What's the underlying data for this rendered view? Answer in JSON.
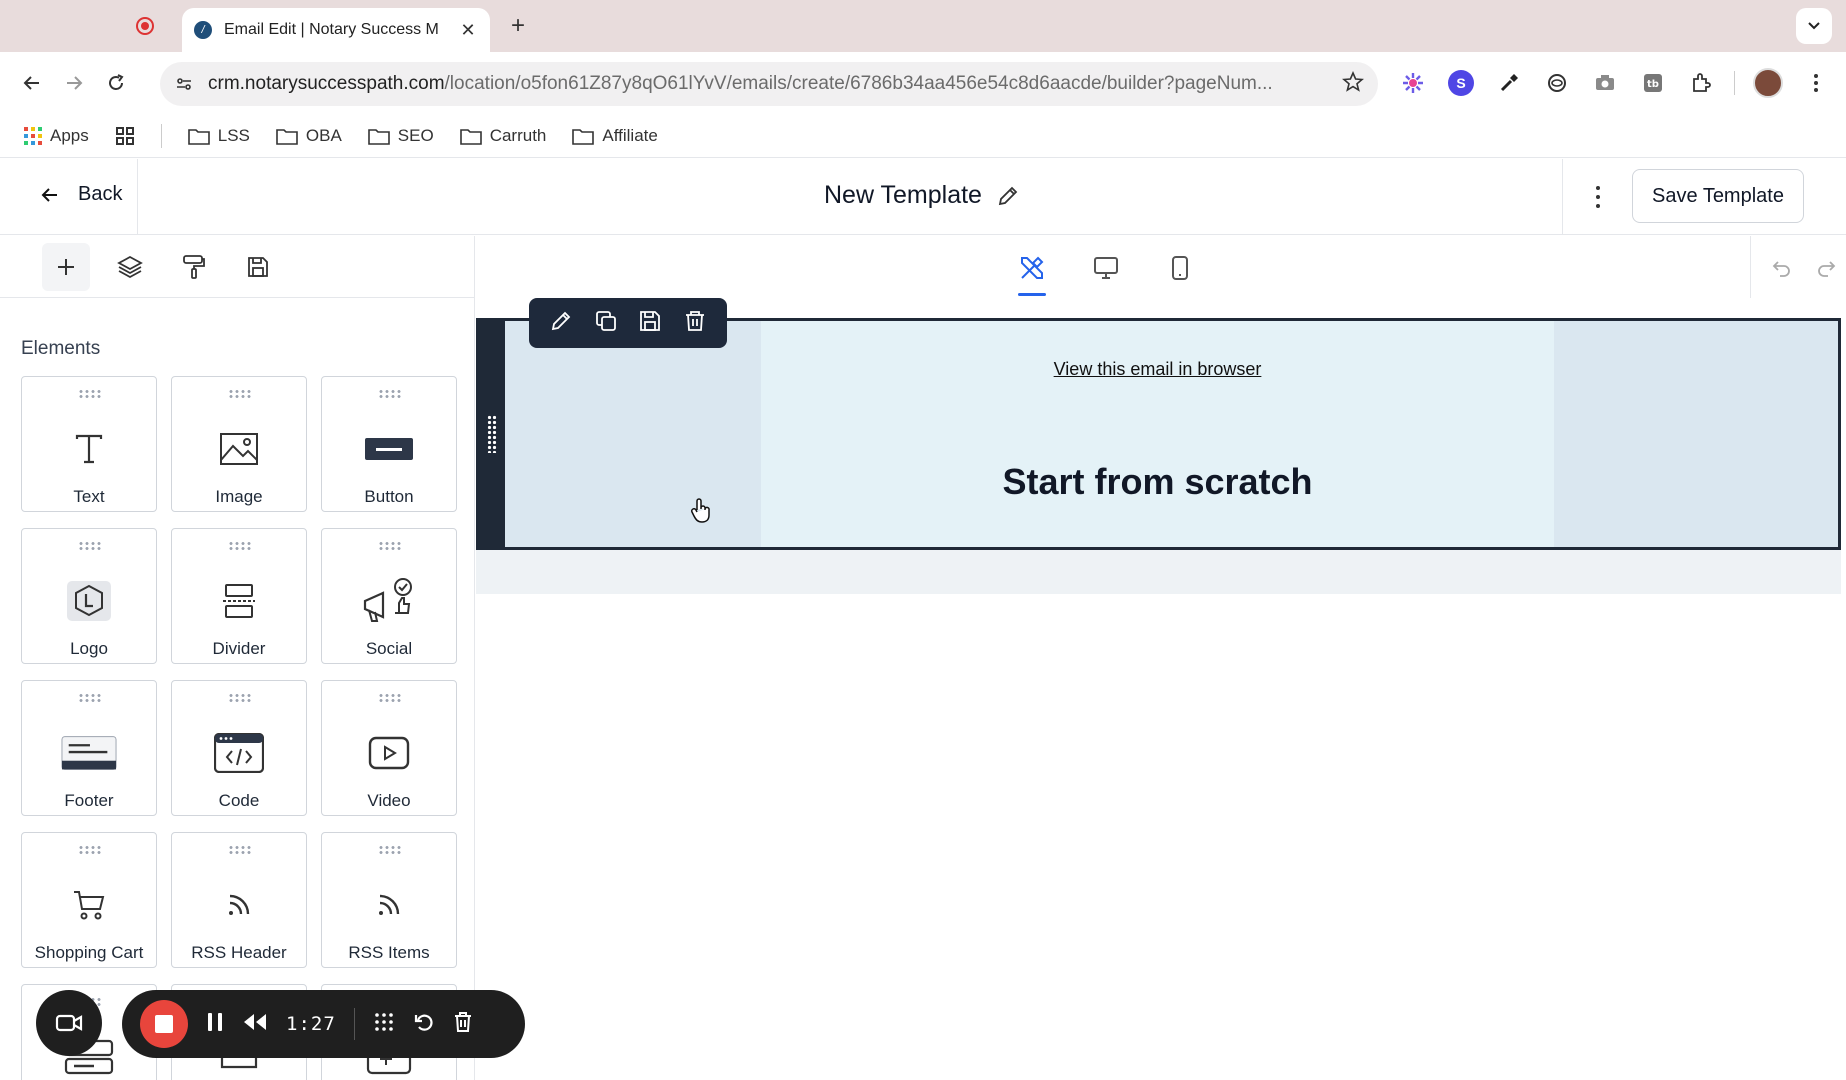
{
  "browser": {
    "tab_title": "Email Edit | Notary Success M",
    "url_host": "crm.notarysuccesspath.com",
    "url_path": "/location/o5fon61Z87y8qO61lYvV/emails/create/6786b34aa456e54c8d6aacde/builder?pageNum...",
    "bookmarks": [
      "Apps",
      "LSS",
      "OBA",
      "SEO",
      "Carruth",
      "Affiliate"
    ]
  },
  "header": {
    "back_label": "Back",
    "template_name": "New Template",
    "save_label": "Save Template"
  },
  "panel": {
    "title": "Elements",
    "elements": [
      {
        "label": "Text",
        "icon": "text-icon"
      },
      {
        "label": "Image",
        "icon": "image-icon"
      },
      {
        "label": "Button",
        "icon": "button-icon"
      },
      {
        "label": "Logo",
        "icon": "logo-icon"
      },
      {
        "label": "Divider",
        "icon": "divider-icon"
      },
      {
        "label": "Social",
        "icon": "social-icon"
      },
      {
        "label": "Footer",
        "icon": "footer-icon"
      },
      {
        "label": "Code",
        "icon": "code-icon"
      },
      {
        "label": "Video",
        "icon": "video-icon"
      },
      {
        "label": "Shopping Cart",
        "icon": "cart-icon"
      },
      {
        "label": "RSS Header",
        "icon": "rss-icon"
      },
      {
        "label": "RSS Items",
        "icon": "rss-icon"
      }
    ]
  },
  "canvas": {
    "view_link": "View this email in browser",
    "headline": "Start from scratch"
  },
  "recorder": {
    "time": "1:27"
  },
  "colors": {
    "accent": "#2563eb",
    "toolbar_dark": "#1e293b",
    "section_bg": "#dae7f0",
    "record_red": "#e8453c"
  }
}
